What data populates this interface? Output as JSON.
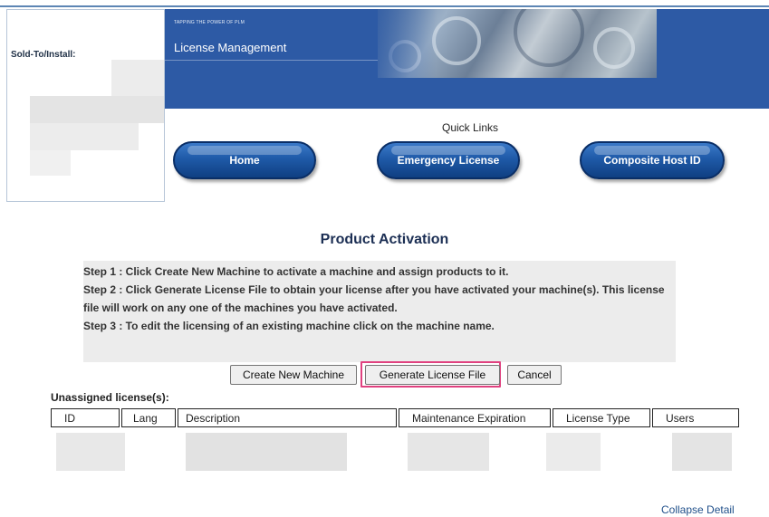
{
  "sold_to": {
    "label": "Sold-To/Install:"
  },
  "banner": {
    "tagline": "TAPPING THE POWER OF PLM",
    "title": "License Management"
  },
  "quick_links": {
    "heading": "Quick Links",
    "buttons": [
      "Home",
      "Emergency License",
      "Composite Host ID"
    ]
  },
  "page": {
    "heading": "Product Activation"
  },
  "steps": [
    "Step 1 : Click Create New Machine to activate a machine and assign products to it.",
    "Step 2 : Click Generate License File to obtain your license after you have activated your machine(s). This license file will work on any one of the machines you have activated.",
    "Step 3 : To edit the licensing of an existing machine click on the machine name."
  ],
  "actions": {
    "create": "Create New Machine",
    "generate": "Generate License File",
    "cancel": "Cancel"
  },
  "table": {
    "caption": "Unassigned license(s):",
    "columns": [
      "ID",
      "Lang",
      "Description",
      "Maintenance Expiration",
      "License Type",
      "Users"
    ]
  },
  "footer": {
    "collapse": "Collapse Detail"
  },
  "colors": {
    "banner": "#2d5aa5",
    "highlight": "#e0417f",
    "link": "#1f4f8a",
    "heading": "#1c2f54"
  }
}
